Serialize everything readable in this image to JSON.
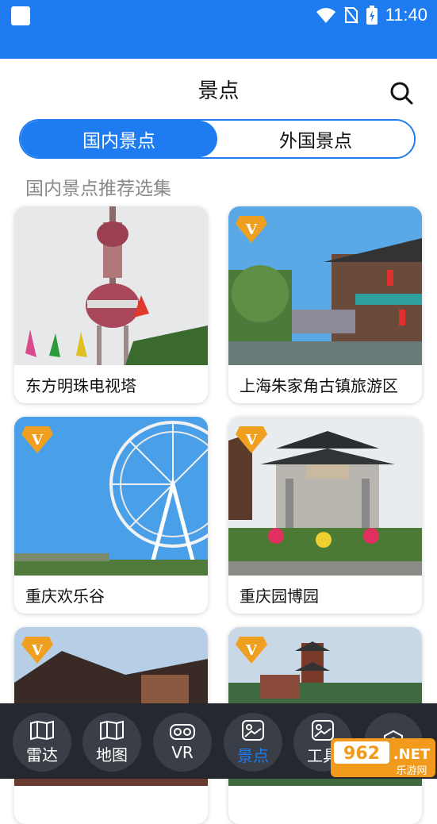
{
  "status_bar": {
    "time": "11:40"
  },
  "header": {
    "title": "景点"
  },
  "segments": [
    {
      "label": "国内景点",
      "active": true
    },
    {
      "label": "外国景点",
      "active": false
    }
  ],
  "section_title": "国内景点推荐选集",
  "attractions": [
    {
      "name": "东方明珠电视塔",
      "vip": false
    },
    {
      "name": "上海朱家角古镇旅游区",
      "vip": true
    },
    {
      "name": "重庆欢乐谷",
      "vip": true
    },
    {
      "name": "重庆园博园",
      "vip": true
    },
    {
      "name": "",
      "vip": true
    },
    {
      "name": "",
      "vip": true
    }
  ],
  "bottom_nav": [
    {
      "label": "雷达",
      "icon": "map-icon",
      "active": false
    },
    {
      "label": "地图",
      "icon": "map-icon",
      "active": false
    },
    {
      "label": "VR",
      "icon": "vr-icon",
      "active": false
    },
    {
      "label": "景点",
      "icon": "scenery-icon",
      "active": true
    },
    {
      "label": "工具",
      "icon": "scenery-icon",
      "active": false
    },
    {
      "label": "",
      "icon": "settings-icon",
      "active": false
    }
  ],
  "watermark": {
    "badge": "962",
    "suffix": ".NET",
    "caption": "乐游网"
  },
  "colors": {
    "primary": "#1e7cf0",
    "nav_bg": "#25282e",
    "vip_orange": "#f0a020"
  }
}
